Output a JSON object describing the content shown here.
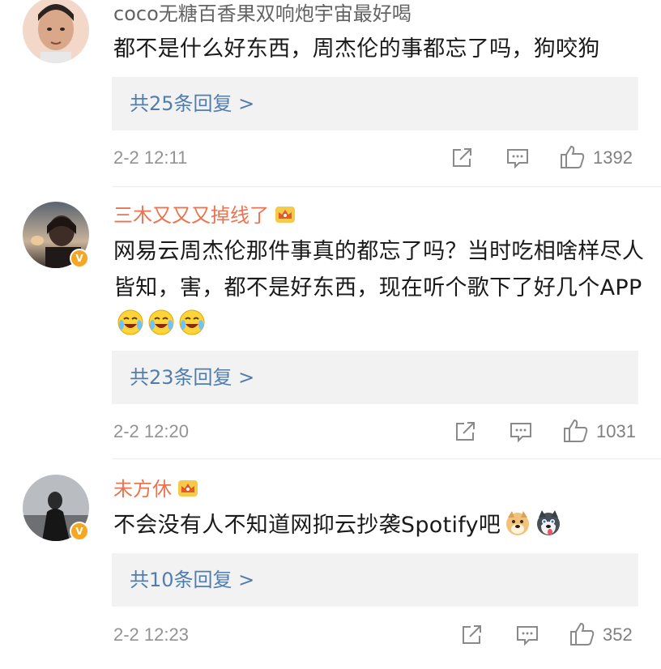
{
  "comments": [
    {
      "username": "coco无糖百香果双响炮宇宙最好喝",
      "text": "都不是什么好东西，周杰伦的事都忘了吗，狗咬狗",
      "replies": "共25条回复 >",
      "time": "2-2 12:11",
      "likes": "1392",
      "vip": false,
      "emojis": []
    },
    {
      "username": "三木又又又掉线了",
      "text": "网易云周杰伦那件事真的都忘了吗？当时吃相啥样尽人皆知，害，都不是好东西，现在听个歌下了好几个APP",
      "replies": "共23条回复 >",
      "time": "2-2 12:20",
      "likes": "1031",
      "vip": true,
      "verified": true,
      "emojis": [
        "laugh-cry-emoji",
        "laugh-cry-emoji",
        "laugh-cry-emoji"
      ]
    },
    {
      "username": "未方休",
      "text": "不会没有人不知道网抑云抄袭Spotify吧",
      "replies": "共10条回复 >",
      "time": "2-2 12:23",
      "likes": "352",
      "vip": true,
      "verified": true,
      "emojis": [
        "doge-emoji",
        "husky-emoji"
      ]
    }
  ],
  "colors": {
    "vip_name": "#eb7350",
    "link": "#507daf",
    "meta": "#939393",
    "reply_bg": "#f2f2f2",
    "badge": "#f5a623"
  }
}
